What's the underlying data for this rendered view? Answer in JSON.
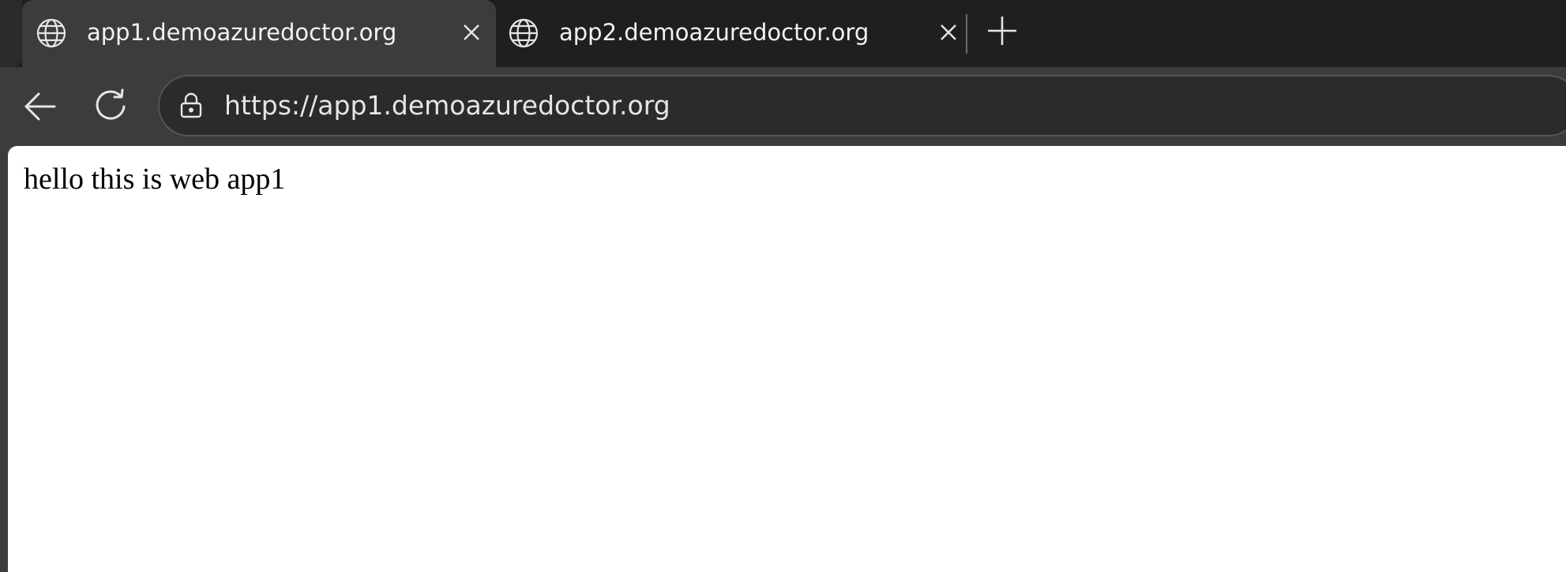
{
  "browser": {
    "tabs": [
      {
        "title": "app1.demoazuredoctor.org",
        "icon": "globe-icon",
        "active": true
      },
      {
        "title": "app2.demoazuredoctor.org",
        "icon": "globe-icon",
        "active": false
      }
    ],
    "address_bar": {
      "url": "https://app1.demoazuredoctor.org",
      "icon": "lock-icon"
    },
    "icons": {
      "back": "back-arrow-icon",
      "reload": "reload-icon",
      "new_tab": "plus-icon",
      "close": "close-icon"
    },
    "colors": {
      "tabstrip": "#1f1f1f",
      "active_tab": "#3c3c3c",
      "address_bar": "#2b2b2b",
      "viewport": "#ffffff"
    }
  },
  "page": {
    "text": "hello this is web app1"
  }
}
